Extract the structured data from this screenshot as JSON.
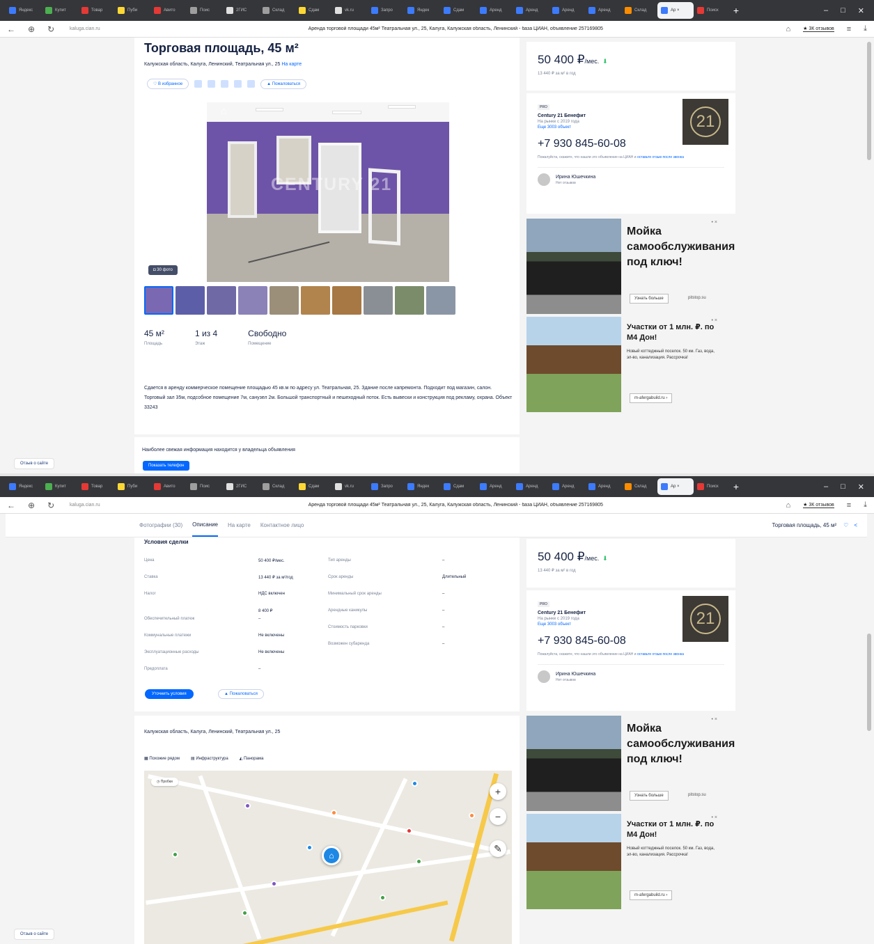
{
  "browser": {
    "tabs": [
      {
        "label": "Яндекс",
        "color": "#3d7bfd"
      },
      {
        "label": "Купит",
        "color": "#4caf50"
      },
      {
        "label": "Товар",
        "color": "#e53935"
      },
      {
        "label": "Пуби",
        "color": "#fdd835"
      },
      {
        "label": "Авито",
        "color": "#e53935"
      },
      {
        "label": "Поис",
        "color": "#9e9e9e"
      },
      {
        "label": "2ГИС",
        "color": "#e0e0e0"
      },
      {
        "label": "Склад",
        "color": "#9e9e9e"
      },
      {
        "label": "Сдам",
        "color": "#fdd835"
      },
      {
        "label": "vk.ru",
        "color": "#e0e0e0"
      },
      {
        "label": "Запро",
        "color": "#3d7bfd"
      },
      {
        "label": "Яндек",
        "color": "#3d7bfd"
      },
      {
        "label": "Сдам",
        "color": "#3d7bfd"
      },
      {
        "label": "Аренд",
        "color": "#3d7bfd"
      },
      {
        "label": "Аренд",
        "color": "#3d7bfd"
      },
      {
        "label": "Аренд",
        "color": "#3d7bfd"
      },
      {
        "label": "Аренд",
        "color": "#3d7bfd"
      },
      {
        "label": "Склад",
        "color": "#fb8c00"
      },
      {
        "label": "Ар ×",
        "color": "#3d7bfd",
        "active": true
      },
      {
        "label": "Поиск",
        "color": "#e53935"
      }
    ],
    "domain": "kaluga.cian.ru",
    "page_title": "Аренда торговой площади 45м² Театральная ул., 25, Калуга, Калужская область, Ленинский - база ЦИАН, объявление 257169805",
    "reviews_label": "★ 3К отзывов"
  },
  "listing": {
    "title": "Торговая площадь, 45 м²",
    "address": "Калужская область, Калуга, Ленинский, Театральная ул., 25",
    "on_map": "На карте",
    "favorites": "В избранное",
    "complain": "Пожаловаться",
    "photo_count": "30 фото",
    "watermark": "CENTURY 21",
    "stats": [
      {
        "value": "45 м²",
        "label": "Площадь"
      },
      {
        "value": "1 из 4",
        "label": "Этаж"
      },
      {
        "value": "Свободно",
        "label": "Помещение"
      }
    ],
    "description": "Сдается в аренду коммерческое помещение площадью 45 кв.м по адресу ул. Театральная, 25. Здание после капремонта. Подходит под магазин, салон. Торговый зал 35м, подсобное помещение 7м, санузел 2м. Большой транспортный и пешеходный поток. Есть вывески и конструкция под рекламу, охрана. Объект 33243",
    "info_note": "Наиболее свежая информация находится у владельца объявления",
    "show_phone": "Показать телефон",
    "feedback": "Отзыв о сайте"
  },
  "sticky_nav": {
    "items": [
      "Фотографии (30)",
      "Описание",
      "На карте",
      "Контактное лицо"
    ],
    "active": "Описание",
    "title": "Торговая площадь, 45 м²"
  },
  "sidebar": {
    "price": "50 400 ₽",
    "price_unit": "/мес.",
    "price_per_m": "13 440 ₽ за м² в год",
    "agency_tag": "PRO",
    "agency": "Century 21 Бенефит",
    "agency_since": "На рынке с 2019 года",
    "agency_more": "Еще 3003 объект",
    "phone": "+7 930 845-60-08",
    "phone_note": "Пожалуйста, скажите, что нашли это объявление на ЦИАН и",
    "phone_note_link": "оставьте отзыв после звонка",
    "person_name": "Ирина Юшечкина",
    "person_sub": "Нет отзывов",
    "logo_text": "21"
  },
  "ads": [
    {
      "title": "Мойка самообслуживания под ключ!",
      "button": "Узнать больше",
      "domain": "pitstop.su"
    },
    {
      "title": "Участки от 1 млн. ₽. по М4 Дон!",
      "text": "Новый коттеджный поселок. 50 км. Газ, вода, эл-во, канализация. Рассрочка!",
      "button": "m-afergabuild.ru ›"
    }
  ],
  "terms": {
    "heading": "Условия сделки",
    "left": [
      {
        "k": "Цена",
        "v": "50 400 ₽/мес."
      },
      {
        "k": "Ставка",
        "v": "13 440 ₽ за м²/год"
      },
      {
        "k": "Налог",
        "v": "НДС включен"
      },
      {
        "k": "",
        "v": "8 400 ₽"
      },
      {
        "k": "Обеспечительный платеж",
        "v": "–"
      },
      {
        "k": "Коммунальные платежи",
        "v": "Не включены"
      },
      {
        "k": "Эксплуатационные расходы",
        "v": "Не включены"
      },
      {
        "k": "Предоплата",
        "v": "–"
      }
    ],
    "right": [
      {
        "k": "Тип аренды",
        "v": "–"
      },
      {
        "k": "Срок аренды",
        "v": "Длительный"
      },
      {
        "k": "Минимальный срок аренды",
        "v": "–"
      },
      {
        "k": "Арендные каникулы",
        "v": "–"
      },
      {
        "k": "Стоимость парковки",
        "v": "–"
      },
      {
        "k": "Возможен субаренда",
        "v": "–"
      }
    ],
    "clarify": "Уточнить условия",
    "complain": "Пожаловаться"
  },
  "map_section": {
    "address": "Калужская область, Калуга, Ленинский, Театральная ул., 25",
    "tabs": [
      "Похожие рядом",
      "Инфраструктура",
      "Панорама"
    ],
    "traffic": "Пробки"
  }
}
